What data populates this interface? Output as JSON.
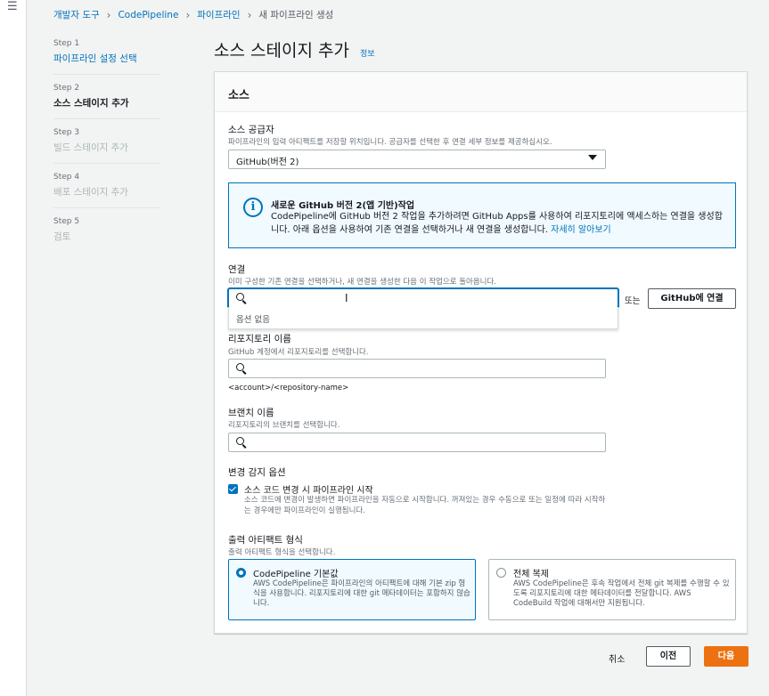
{
  "nav": {
    "menu_icon": "menu-icon"
  },
  "breadcrumb": {
    "items": [
      "개발자 도구",
      "CodePipeline",
      "파이프라인"
    ],
    "current": "새 파이프라인 생성",
    "separator": "›"
  },
  "steps": [
    {
      "num": "Step 1",
      "label": "파이프라인 설정 선택",
      "state": "link"
    },
    {
      "num": "Step 2",
      "label": "소스 스테이지 추가",
      "state": "active"
    },
    {
      "num": "Step 3",
      "label": "빌드 스테이지 추가",
      "state": "disabled"
    },
    {
      "num": "Step 4",
      "label": "배포 스테이지 추가",
      "state": "disabled"
    },
    {
      "num": "Step 5",
      "label": "검토",
      "state": "disabled"
    }
  ],
  "page": {
    "title": "소스 스테이지 추가",
    "info": "정보"
  },
  "panel": {
    "title": "소스"
  },
  "provider": {
    "label": "소스 공급자",
    "desc": "파이프라인의 입력 아티팩트를 저장할 위치입니다. 공급자를 선택한 후 연결 세부 정보를 제공하십시오.",
    "value": "GitHub(버전 2)"
  },
  "info_box": {
    "icon": "info-icon",
    "title": "새로운 GitHub 버전 2(앱 기반)작업",
    "body": "CodePipeline에 GitHub 버전 2 작업을 추가하려면 GitHub Apps를 사용하여 리포지토리에 액세스하는 연결을 생성합니다. 아래 옵션을 사용하여 기존 연결을 선택하거나 새 연결을 생성합니다.",
    "link": "자세히 알아보기"
  },
  "connection": {
    "label": "연결",
    "desc": "이미 구성한 기존 연결을 선택하거나, 새 연결을 생성한 다음 이 작업으로 돌아옵니다.",
    "value": "",
    "dropdown_option": "옵션 없음",
    "or": "또는",
    "connect_button": "GitHub에 연결"
  },
  "repository": {
    "label": "리포지토리 이름",
    "desc": "GitHub 계정에서 리포지토리를 선택합니다.",
    "value": "",
    "hint": "<account>/<repository-name>"
  },
  "branch": {
    "label": "브랜치 이름",
    "desc": "리포지토리의 브랜치를 선택합니다.",
    "value": ""
  },
  "change_detection": {
    "label": "변경 감지 옵션",
    "checkbox_label": "소스 코드 변경 시 파이프라인 시작",
    "checkbox_desc": "소스 코드에 변경이 발생하면 파이프라인을 자동으로 시작합니다. 꺼져있는 경우 수동으로 또는 일정에 따라 시작하는 경우에만 파이프라인이 실행됩니다.",
    "checked": true
  },
  "artifact": {
    "label": "출력 아티팩트 형식",
    "desc": "출력 아티팩트 형식을 선택합니다.",
    "options": [
      {
        "title": "CodePipeline 기본값",
        "desc": "AWS CodePipeline은 파이프라인의 아티팩트에 대해 기본 zip 형식을 사용합니다. 리포지토리에 대한 git 메타데이터는 포함하지 않습니다.",
        "selected": true
      },
      {
        "title": "전체 복제",
        "desc": "AWS CodePipeline은 후속 작업에서 전체 git 복제를 수행할 수 있도록 리포지토리에 대한 메타데이터를 전달합니다. AWS CodeBuild 작업에 대해서만 지원됩니다.",
        "selected": false
      }
    ]
  },
  "footer": {
    "cancel": "취소",
    "previous": "이전",
    "next": "다음"
  },
  "colors": {
    "accent": "#0073bb",
    "primary_button": "#ec7211"
  }
}
